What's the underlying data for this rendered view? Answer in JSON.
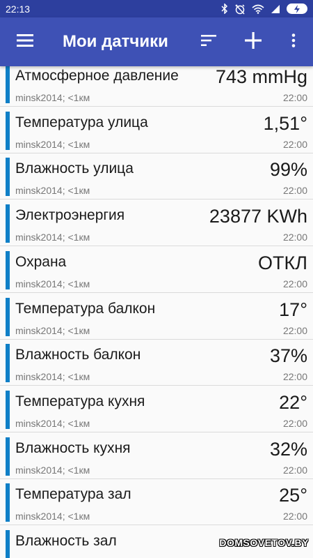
{
  "status_bar": {
    "time": "22:13",
    "icons": [
      "bluetooth-icon",
      "alarm-off-icon",
      "wifi-icon",
      "signal-icon",
      "battery-charging-icon"
    ]
  },
  "app_bar": {
    "title": "Мои датчики",
    "icons": [
      "menu-icon",
      "sort-icon",
      "add-icon",
      "more-vert-icon"
    ],
    "color": "#3e51b5"
  },
  "colors": {
    "accent_bar": "#0f7fc7",
    "status_bar": "#2d3f9e"
  },
  "sensors": [
    {
      "name": "Атмосферное давление",
      "value": "743 mmHg",
      "source": "minsk2014; <1км",
      "time": "22:00"
    },
    {
      "name": "Температура улица",
      "value": "1,51°",
      "source": "minsk2014; <1км",
      "time": "22:00"
    },
    {
      "name": "Влажность улица",
      "value": "99%",
      "source": "minsk2014; <1км",
      "time": "22:00"
    },
    {
      "name": "Электроэнергия",
      "value": "23877 KWh",
      "source": "minsk2014; <1км",
      "time": "22:00"
    },
    {
      "name": "Охрана",
      "value": "ОТКЛ",
      "source": "minsk2014; <1км",
      "time": "22:00"
    },
    {
      "name": "Температура балкон",
      "value": "17°",
      "source": "minsk2014; <1км",
      "time": "22:00"
    },
    {
      "name": "Влажность балкон",
      "value": "37%",
      "source": "minsk2014; <1км",
      "time": "22:00"
    },
    {
      "name": "Температура кухня",
      "value": "22°",
      "source": "minsk2014; <1км",
      "time": "22:00"
    },
    {
      "name": "Влажность кухня",
      "value": "32%",
      "source": "minsk2014; <1км",
      "time": "22:00"
    },
    {
      "name": "Температура зал",
      "value": "25°",
      "source": "minsk2014; <1км",
      "time": "22:00"
    },
    {
      "name": "Влажность зал",
      "value": "",
      "source": "",
      "time": ""
    }
  ],
  "watermark": "DOMSOVETOV.BY"
}
